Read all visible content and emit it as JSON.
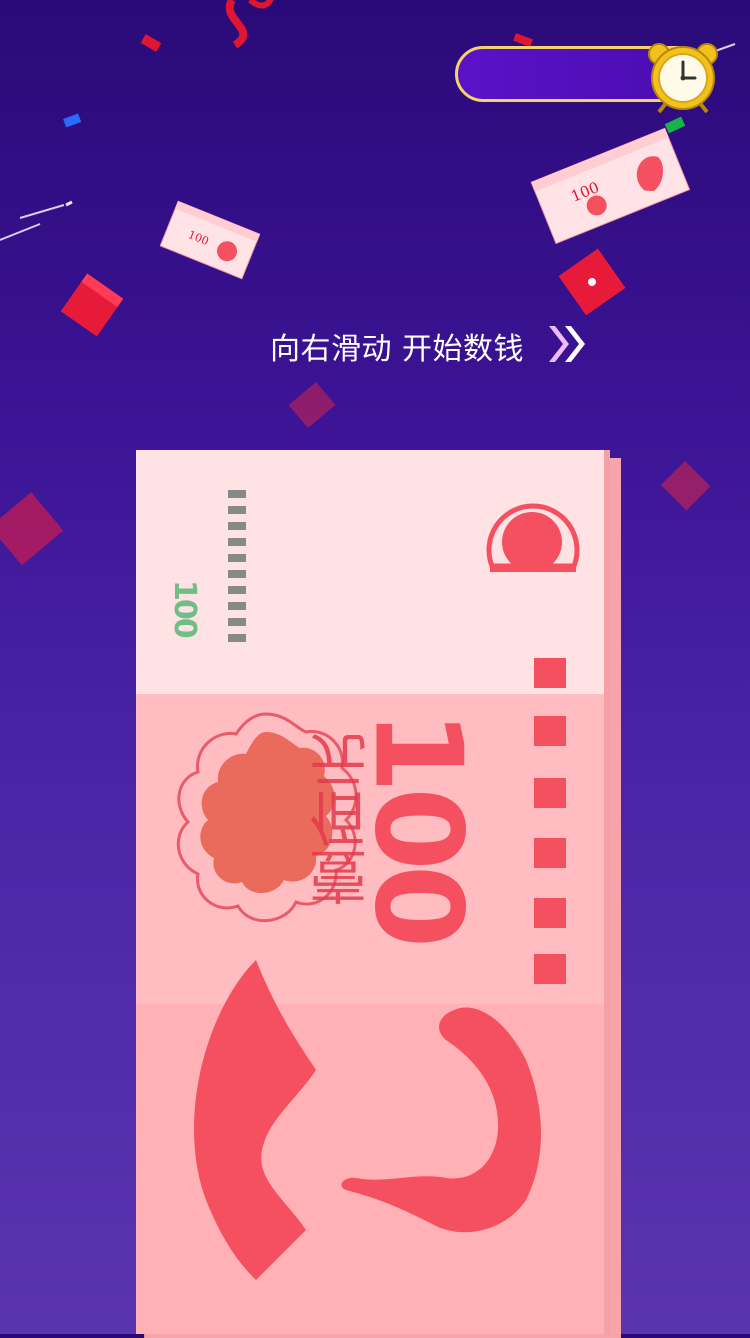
{
  "instruction": {
    "text": "向右滑动 开始数钱"
  },
  "timer": {
    "icon": "alarm-clock-icon"
  },
  "banknote": {
    "denomination": "100",
    "chinese_amount": "壹佰元"
  },
  "mini_bills": [
    {
      "denomination": "100"
    },
    {
      "denomination": "100"
    }
  ],
  "colors": {
    "background_top": "#2a0a78",
    "background_bottom": "#5a34b0",
    "note_red": "#f5505f",
    "note_pink": "#ffb3b8",
    "timer_border": "#f4d36a"
  }
}
